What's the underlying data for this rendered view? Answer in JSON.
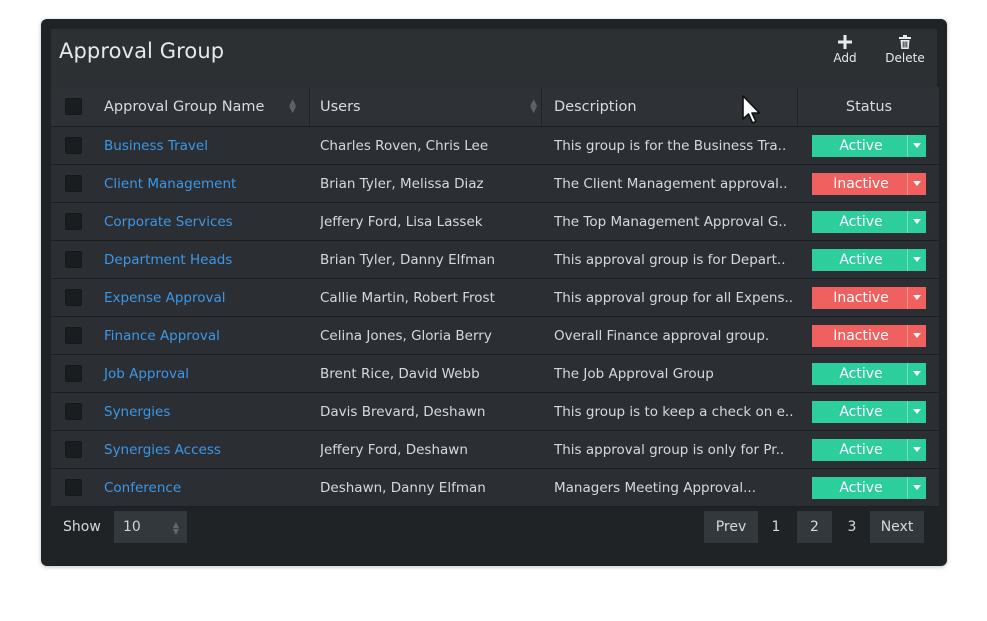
{
  "panel": {
    "title": "Approval Group",
    "add_label": "Add",
    "delete_label": "Delete"
  },
  "table": {
    "columns": [
      "Approval Group Name",
      "Users",
      "Description",
      "Status"
    ],
    "rows": [
      {
        "name": "Business Travel",
        "users": "Charles Roven, Chris Lee",
        "description": "This group is for the Business Tra..",
        "status": "Active"
      },
      {
        "name": "Client Management",
        "users": "Brian Tyler, Melissa Diaz",
        "description": "The Client Management approval..",
        "status": "Inactive"
      },
      {
        "name": "Corporate Services",
        "users": "Jeffery Ford, Lisa Lassek",
        "description": "The Top Management Approval G..",
        "status": "Active"
      },
      {
        "name": "Department Heads",
        "users": "Brian Tyler, Danny Elfman",
        "description": "This approval group is for Depart..",
        "status": "Active"
      },
      {
        "name": "Expense Approval",
        "users": "Callie Martin, Robert Frost",
        "description": "This approval group for all Expens..",
        "status": "Inactive"
      },
      {
        "name": "Finance Approval",
        "users": "Celina Jones, Gloria Berry",
        "description": "Overall Finance approval group.",
        "status": "Inactive"
      },
      {
        "name": "Job Approval",
        "users": "Brent Rice, David Webb",
        "description": "The Job Approval Group",
        "status": "Active"
      },
      {
        "name": "Synergies",
        "users": "Davis Brevard, Deshawn",
        "description": "This group is to keep a check on e..",
        "status": "Active"
      },
      {
        "name": "Synergies Access",
        "users": "Jeffery Ford, Deshawn",
        "description": "This approval group is only for Pr..",
        "status": "Active"
      },
      {
        "name": "Conference",
        "users": "Deshawn, Danny Elfman",
        "description": "Managers Meeting Approval...",
        "status": "Active"
      }
    ]
  },
  "footer": {
    "show_label": "Show",
    "show_value": "10",
    "pagination": {
      "prev": "Prev",
      "pages": [
        "1",
        "2",
        "3"
      ],
      "current_page": "2",
      "next": "Next"
    }
  },
  "colors": {
    "active": "#2ccf9c",
    "inactive": "#f0605f",
    "link": "#3c97e6"
  },
  "icons": [
    "plus-icon",
    "trash-icon",
    "sort-icon",
    "chevron-down-icon",
    "mouse-cursor-icon"
  ]
}
